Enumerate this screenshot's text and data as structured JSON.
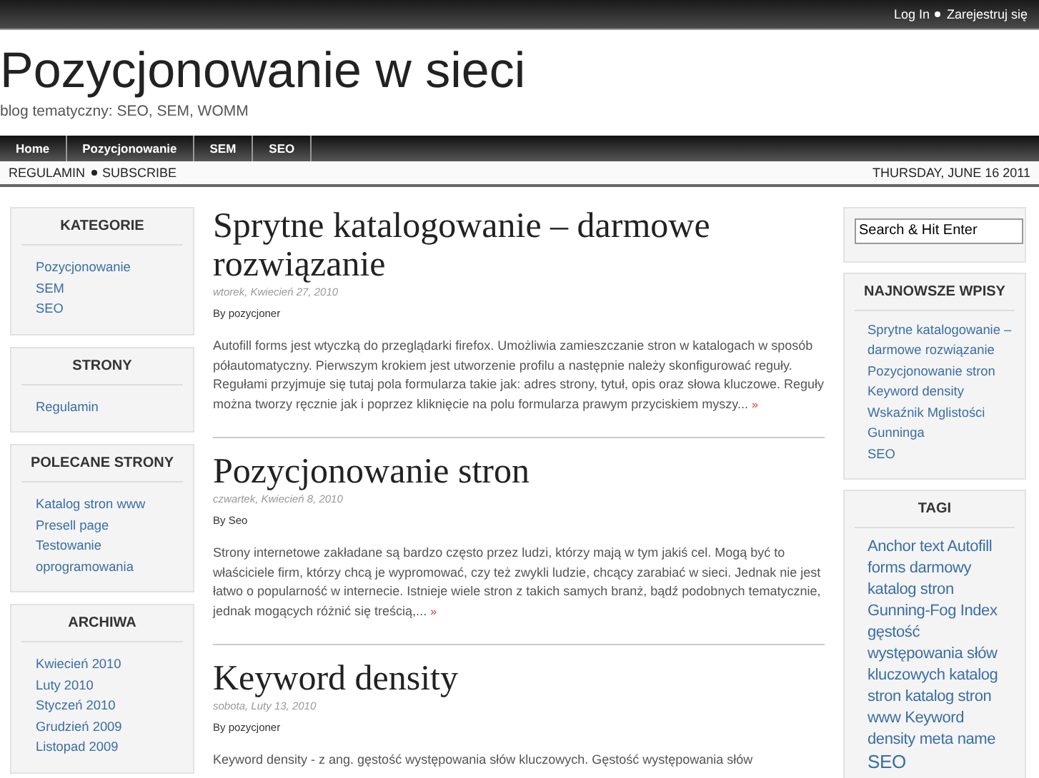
{
  "top_links": [
    "Log In",
    "Zarejestruj się"
  ],
  "site": {
    "title": "Pozycjonowanie w sieci",
    "tagline": "blog tematyczny: SEO, SEM, WOMM"
  },
  "nav": [
    {
      "label": "Home"
    },
    {
      "label": "Pozycjonowanie"
    },
    {
      "label": "SEM"
    },
    {
      "label": "SEO"
    }
  ],
  "subnav": {
    "links": [
      "REGULAMIN",
      "SUBSCRIBE"
    ],
    "date": "THURSDAY, JUNE 16 2011"
  },
  "left_sidebar": [
    {
      "title": "KATEGORIE",
      "links": [
        "Pozycjonowanie",
        "SEM",
        "SEO"
      ]
    },
    {
      "title": "STRONY",
      "links": [
        "Regulamin"
      ]
    },
    {
      "title": "POLECANE STRONY",
      "links": [
        "Katalog stron www",
        "Presell page",
        "Testowanie oprogramowania"
      ]
    },
    {
      "title": "ARCHIWA",
      "links": [
        "Kwiecień 2010",
        "Luty 2010",
        "Styczeń 2010",
        "Grudzień 2009",
        "Listopad 2009"
      ]
    }
  ],
  "posts": [
    {
      "title": "Sprytne katalogowanie – darmowe rozwiązanie",
      "date": "wtorek, Kwiecień 27, 2010",
      "author": "By pozycjoner",
      "excerpt": "Autofill forms jest wtyczką do przeglądarki firefox. Umożliwia zamieszczanie stron w katalogach w sposób półautomatyczny. Pierwszym krokiem jest utworzenie profilu a następnie należy skonfigurować reguły. Regułami przyjmuje się tutaj pola formularza takie jak: adres strony, tytuł, opis oraz słowa kluczowe. Reguły można tworzy ręcznie jak i poprzez kliknięcie na polu formularza prawym przyciskiem myszy...",
      "more": "»"
    },
    {
      "title": "Pozycjonowanie stron",
      "date": "czwartek, Kwiecień 8, 2010",
      "author": "By Seo",
      "excerpt": "Strony internetowe zakładane są bardzo często przez ludzi, którzy mają w tym jakiś cel. Mogą być to właściciele firm, którzy chcą je wypromować, czy też zwykli ludzie, chcący zarabiać w sieci. Jednak nie jest łatwo o popularność w internecie. Istnieje wiele stron z takich samych branż, bądź podobnych tematycznie, jednak mogących różnić się treścią,...",
      "more": "»"
    },
    {
      "title": "Keyword density",
      "date": "sobota, Luty 13, 2010",
      "author": "By pozycjoner",
      "excerpt": "Keyword density - z ang. gęstość występowania słów kluczowych. Gęstość występowania słów"
    }
  ],
  "search": {
    "value": "Search & Hit Enter"
  },
  "recent": {
    "title": "NAJNOWSZE WPISY",
    "links": [
      "Sprytne katalogowanie – darmowe rozwiązanie",
      "Pozycjonowanie stron",
      "Keyword density",
      "Wskaźnik Mglistości Gunninga",
      "SEO"
    ]
  },
  "tags": {
    "title": "TAGI",
    "items": [
      {
        "label": "Anchor text",
        "kind": "normal"
      },
      {
        "label": "Autofill forms",
        "kind": "normal"
      },
      {
        "label": "darmowy katalog stron",
        "kind": "normal"
      },
      {
        "label": "Gunning-Fog Index",
        "kind": "normal"
      },
      {
        "label": "gęstość występowania słów kluczowych",
        "kind": "normal"
      },
      {
        "label": "katalog stron",
        "kind": "normal"
      },
      {
        "label": "katalog stron www",
        "kind": "normal"
      },
      {
        "label": "Keyword density",
        "kind": "normal"
      },
      {
        "label": "meta name",
        "kind": "normal"
      },
      {
        "label": "SEO",
        "kind": "large"
      }
    ]
  }
}
